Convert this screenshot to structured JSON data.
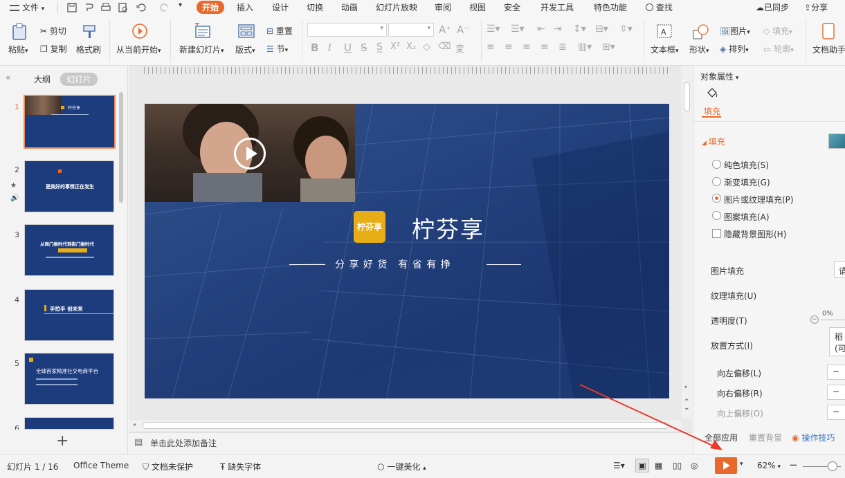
{
  "menubar": {
    "file": "文件",
    "tabs": [
      "开始",
      "插入",
      "设计",
      "切换",
      "动画",
      "幻灯片放映",
      "审阅",
      "视图",
      "安全",
      "开发工具",
      "特色功能"
    ],
    "search": "查找",
    "sync": "已同步",
    "share": "分享"
  },
  "ribbon": {
    "paste": "粘贴",
    "cut": "剪切",
    "copy": "复制",
    "format_painter": "格式刷",
    "play_from_current": "从当前开始",
    "new_slide": "新建幻灯片",
    "layout": "版式",
    "reset": "重置",
    "section": "节",
    "textbox": "文本框",
    "shape": "形状",
    "picture": "图片",
    "fill": "填充",
    "arrange": "排列",
    "outline": "轮廓",
    "doc_assistant": "文档助手"
  },
  "leftpanel": {
    "tab_outline": "大纲",
    "tab_slides": "幻灯片",
    "thumbnails": [
      {
        "num": "1",
        "text": "柠芬享"
      },
      {
        "num": "2",
        "text": "更美好的事情正在发生"
      },
      {
        "num": "3",
        "text": "从商门推时代到街门推时代"
      },
      {
        "num": "4",
        "text": "手拉手 创未来"
      },
      {
        "num": "5",
        "text": "全球首家精准社交电商平台"
      },
      {
        "num": "6",
        "text": ""
      }
    ],
    "add_slide": "+"
  },
  "slide": {
    "logo_text": "柠芬享",
    "title": "柠芬享",
    "subtitle": "分 享 好 货　有 省 有 挣"
  },
  "notes": {
    "placeholder": "单击此处添加备注"
  },
  "rightpanel": {
    "header": "对象属性",
    "tab_fill": "填充",
    "section_fill": "填充",
    "options": [
      {
        "label": "纯色填充(S)",
        "selected": false
      },
      {
        "label": "渐变填充(G)",
        "selected": false
      },
      {
        "label": "图片或纹理填充(P)",
        "selected": true
      },
      {
        "label": "图案填充(A)",
        "selected": false
      }
    ],
    "hide_bg": "隐藏背景图形(H)",
    "picture_fill": "图片填充",
    "picture_fill_btn": "请",
    "texture_fill": "纹理填充(U)",
    "transparency": "透明度(T)",
    "transparency_value": "0%",
    "placement": "放置方式(I)",
    "placement_value_1": "稻",
    "placement_value_2": "(可",
    "offset_left": "向左偏移(L)",
    "offset_right": "向右偏移(R)",
    "offset_up": "向上偏移(O)",
    "apply_all": "全部应用",
    "reset_bg": "重置背景",
    "tips": "操作技巧"
  },
  "statusbar": {
    "slide_info": "幻灯片 1 / 16",
    "theme": "Office Theme",
    "doc_protect": "文档未保护",
    "missing_font": "缺失字体",
    "beautify": "一键美化",
    "zoom": "62%"
  },
  "colors": {
    "accent": "#e9692c",
    "slide_blue": "#1f3c78",
    "logo_yellow": "#e8ac14"
  }
}
